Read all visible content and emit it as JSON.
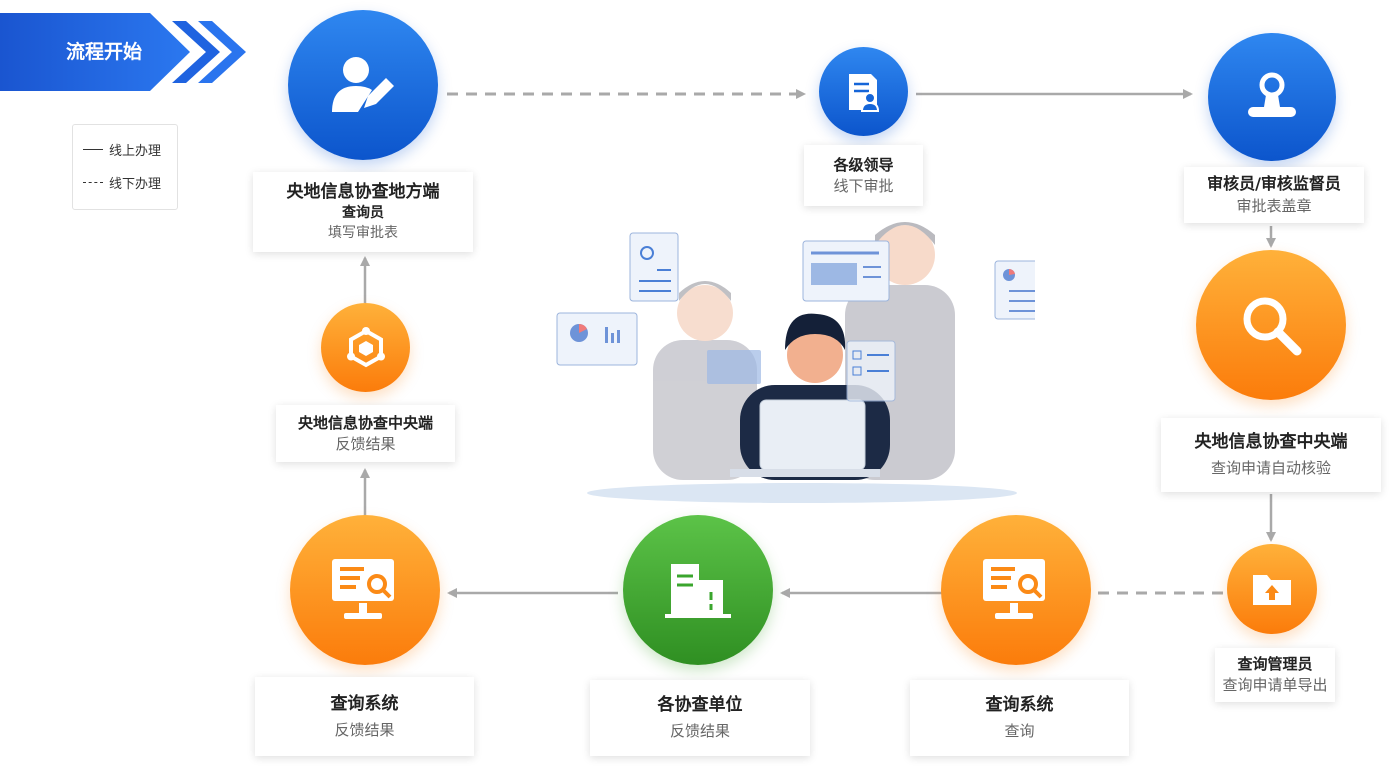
{
  "start_banner": {
    "label": "流程开始"
  },
  "legend": {
    "online": "线上办理",
    "offline": "线下办理"
  },
  "nodes": {
    "local_query": {
      "title": "央地信息协查地方端",
      "subtitle": "查询员",
      "action": "填写审批表"
    },
    "leaders": {
      "title": "各级领导",
      "action": "线下审批"
    },
    "auditor": {
      "title": "审核员/审核监督员",
      "action": "审批表盖章"
    },
    "central_check": {
      "title": "央地信息协查中央端",
      "action": "查询申请自动核验"
    },
    "query_admin": {
      "title": "查询管理员",
      "action": "查询申请单导出"
    },
    "query_system_right": {
      "title": "查询系统",
      "action": "查询"
    },
    "units": {
      "title": "各协查单位",
      "action": "反馈结果"
    },
    "query_system_left": {
      "title": "查询系统",
      "action": "反馈结果"
    },
    "central_feedback": {
      "title": "央地信息协查中央端",
      "action": "反馈结果"
    }
  },
  "icons": {
    "local_query": "user-edit-icon",
    "leaders": "document-user-icon",
    "auditor": "stamp-icon",
    "central_check": "magnifier-icon",
    "query_admin": "folder-upload-icon",
    "query_system": "monitor-search-icon",
    "units": "building-icon",
    "central_feedback": "hexagon-network-icon"
  },
  "colors": {
    "blue": "#1565d8",
    "orange": "#fb8a16",
    "green": "#3aa52d",
    "arrow": "#a9a9a9",
    "banner": "#1558d6"
  }
}
